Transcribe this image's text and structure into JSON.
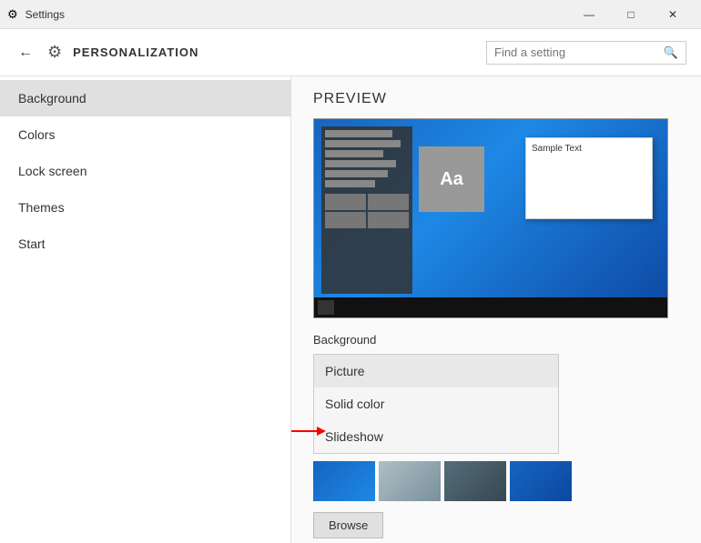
{
  "titlebar": {
    "title": "Settings",
    "minimize_label": "—",
    "maximize_label": "□",
    "close_label": "✕"
  },
  "header": {
    "back_icon": "←",
    "gear_icon": "⚙",
    "title": "PERSONALIZATION",
    "search_placeholder": "Find a setting",
    "search_icon": "🔍"
  },
  "sidebar": {
    "items": [
      {
        "label": "Background",
        "active": true
      },
      {
        "label": "Colors",
        "active": false
      },
      {
        "label": "Lock screen",
        "active": false
      },
      {
        "label": "Themes",
        "active": false
      },
      {
        "label": "Start",
        "active": false
      }
    ]
  },
  "content": {
    "preview_title": "PREVIEW",
    "preview_dialog_text": "Sample Text",
    "preview_aa": "Aa",
    "background_label": "Background",
    "dropdown_items": [
      {
        "label": "Picture",
        "selected": false
      },
      {
        "label": "Solid color",
        "selected": false
      },
      {
        "label": "Slideshow",
        "selected": false
      }
    ],
    "browse_label": "Browse",
    "thumbnails": [
      {
        "name": "thumb-blue-sky"
      },
      {
        "name": "thumb-ice"
      },
      {
        "name": "thumb-dark-water"
      },
      {
        "name": "thumb-windows-desktop"
      }
    ]
  }
}
